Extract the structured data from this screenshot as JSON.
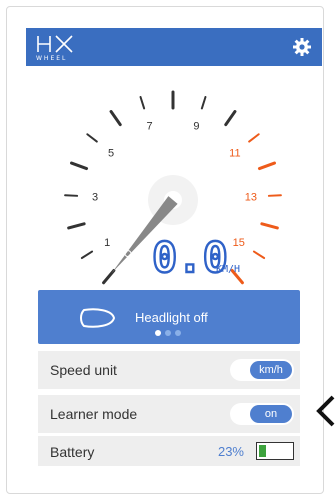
{
  "app": {
    "logo_text": "HX",
    "logo_subtext": "WHEEL"
  },
  "header": {
    "settings_icon": "gear-icon",
    "background": "#3a6ec0"
  },
  "speedometer": {
    "speed_value": "0.0",
    "speed_unit_label": "KM/H",
    "dial_labels": [
      "1",
      "3",
      "5",
      "7",
      "9",
      "11",
      "13",
      "15"
    ],
    "normal_color": "#333333",
    "warning_color": "#ee5b1a",
    "needle_value": 0
  },
  "headlight_panel": {
    "status_text": "Headlight off",
    "icon": "headlight-icon",
    "page_dots": {
      "count": 3,
      "active_index": 0
    }
  },
  "settings": {
    "speed_unit": {
      "label": "Speed unit",
      "value": "km/h"
    },
    "learner_mode": {
      "label": "Learner mode",
      "value": "on"
    },
    "battery": {
      "label": "Battery",
      "percent_text": "23%",
      "level": 0.23
    }
  },
  "colors": {
    "accent": "#4f7fcf",
    "battery_green": "#3da33d"
  }
}
